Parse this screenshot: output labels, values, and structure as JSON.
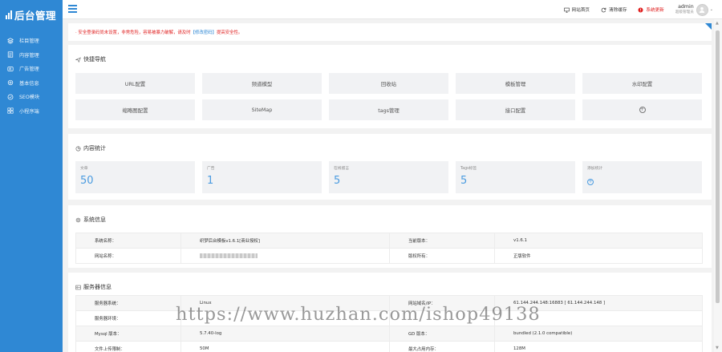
{
  "sidebar": {
    "logo": "后台管理",
    "items": [
      {
        "label": "栏目管理",
        "icon": "layers-icon"
      },
      {
        "label": "内容管理",
        "icon": "document-icon"
      },
      {
        "label": "广告管理",
        "icon": "ad-icon"
      },
      {
        "label": "基本信息",
        "icon": "gear-icon"
      },
      {
        "label": "SEO模块",
        "icon": "seo-icon"
      },
      {
        "label": "小程序端",
        "icon": "grid-icon"
      }
    ]
  },
  "header": {
    "links": [
      {
        "label": "网站首页",
        "icon": "monitor-icon"
      },
      {
        "label": "清除缓存",
        "icon": "refresh-icon"
      },
      {
        "label": "系统更新",
        "icon": "alert-icon"
      }
    ],
    "user": {
      "name": "admin",
      "role": "超级管理员"
    }
  },
  "notice": {
    "text_before": "· 安全登录码尚未设置，非常危险，容易被暴力破解，请及时",
    "link": "【修改密码】",
    "text_after": "提高安全性。"
  },
  "quick_nav": {
    "title": "快捷导航",
    "items": [
      "URL配置",
      "频道模型",
      "回收站",
      "模板管理",
      "水印配置",
      "缩略图配置",
      "SiteMap",
      "tags管理",
      "接口配置",
      "+"
    ]
  },
  "content_stats": {
    "title": "内容统计",
    "items": [
      {
        "label": "文章",
        "value": "50"
      },
      {
        "label": "广告",
        "value": "1"
      },
      {
        "label": "在线留言",
        "value": "5"
      },
      {
        "label": "Tags标签",
        "value": "5"
      },
      {
        "label": "添加统计",
        "value": "+"
      }
    ]
  },
  "system_info": {
    "title": "系统信息",
    "rows": [
      {
        "k1": "系统名称：",
        "v1": "织梦后台模板v1.6.1[商业授权]",
        "k2": "当前版本：",
        "v2": "v1.6.1"
      },
      {
        "k1": "网站名称：",
        "v1": "",
        "k2": "版权所有：",
        "v2": "正版软件"
      }
    ]
  },
  "server_info": {
    "title": "服务器信息",
    "rows": [
      {
        "k1": "服务器系统：",
        "v1": "Linux",
        "k2": "网站域名/IP：",
        "v2": "61.144.244.148:16883 [ 61.144.244.148 ]"
      },
      {
        "k1": "服务器环境：",
        "v1": "",
        "k2": "",
        "v2": ""
      },
      {
        "k1": "Mysql 版本：",
        "v1": "5.7.40-log",
        "k2": "GD 版本：",
        "v2": "bundled (2.1.0 compatible)"
      },
      {
        "k1": "文件上传限制：",
        "v1": "50M",
        "k2": "最大占用内存：",
        "v2": "128M"
      }
    ]
  },
  "watermark": "https://www.huzhan.com/ishop49138",
  "colors": {
    "primary": "#2f88d4",
    "danger": "#e02020",
    "stat_value": "#4a9be0"
  }
}
